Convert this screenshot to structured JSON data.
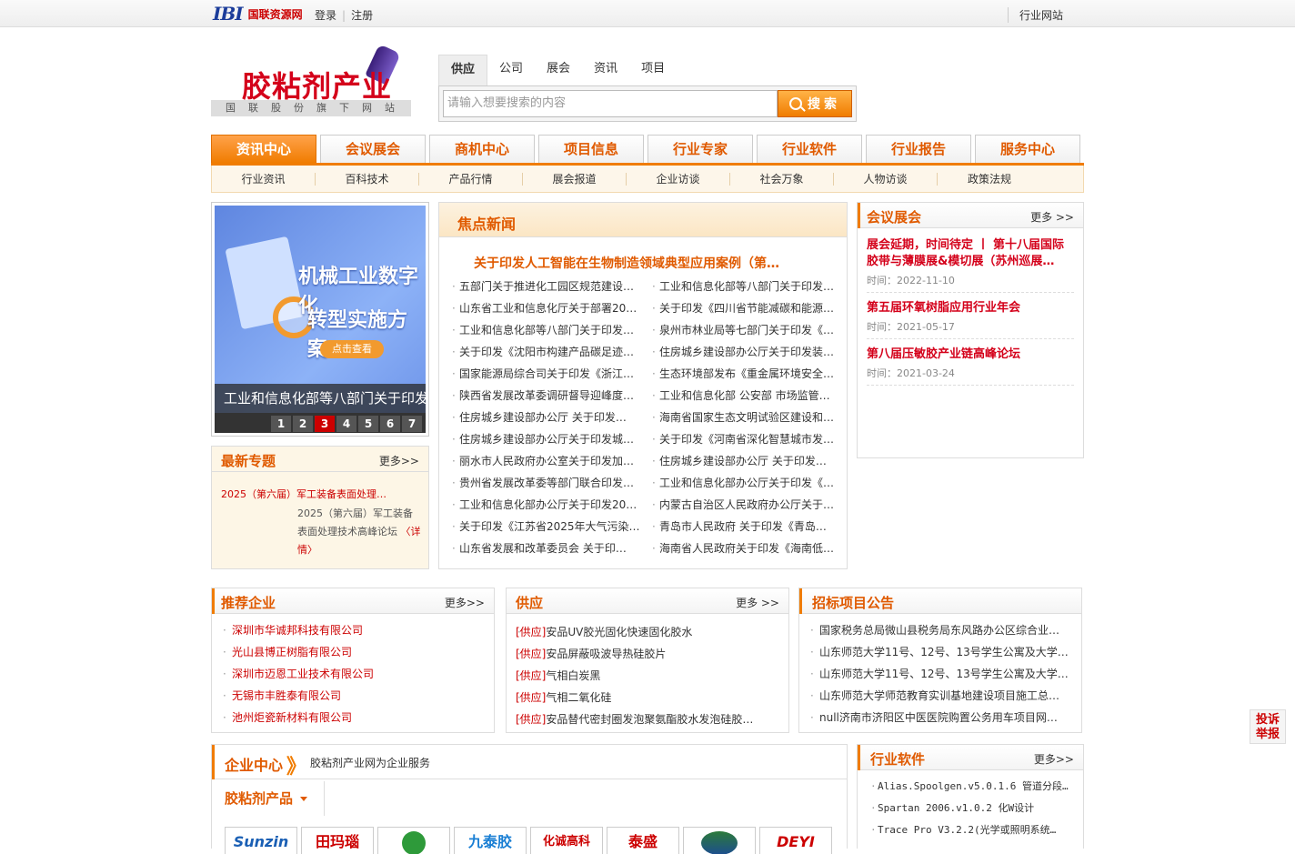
{
  "topbar": {
    "logo_text": "IBI",
    "site_name": "国联资源网",
    "login": "登录",
    "register": "注册",
    "industry_sites": "行业网站"
  },
  "brand": {
    "title": "胶粘剂产业",
    "subtitle": "国联股份旗下网站"
  },
  "search": {
    "tabs": [
      "供应",
      "公司",
      "展会",
      "资讯",
      "项目"
    ],
    "placeholder": "请输入想要搜索的内容",
    "button": "搜索"
  },
  "nav": {
    "items": [
      "资讯中心",
      "会议展会",
      "商机中心",
      "项目信息",
      "行业专家",
      "行业软件",
      "行业报告",
      "服务中心"
    ]
  },
  "subnav": {
    "items": [
      "行业资讯",
      "百科技术",
      "产品行情",
      "展会报道",
      "企业访谈",
      "社会万象",
      "人物访谈",
      "政策法规"
    ]
  },
  "slider": {
    "title_line1": "机械工业数字化",
    "title_line2": "转型实施方案",
    "button": "点击查看",
    "caption": "工业和信息化部等八部门关于印发",
    "dots": [
      "1",
      "2",
      "3",
      "4",
      "5",
      "6",
      "7"
    ],
    "active_dot": 3
  },
  "topic": {
    "title": "最新专题",
    "more": "更多>>",
    "lead": "2025（第六届）军工装备表面处理…",
    "desc": "2025（第六届）军工装备表面处理技术高峰论坛",
    "detail": "〈详情〉"
  },
  "focus": {
    "title": "焦点新闻",
    "headline": "关于印发人工智能在生物制造领域典型应用案例（第…",
    "left": [
      "五部门关于推进化工园区规范建设…",
      "山东省工业和信息化厅关于部署20…",
      "工业和信息化部等八部门关于印发…",
      "关于印发《沈阳市构建产品碳足迹…",
      "国家能源局综合司关于印发《浙江…",
      "陕西省发展改革委调研督导迎峰度…",
      "住房城乡建设部办公厅 关于印发…",
      "住房城乡建设部办公厅关于印发城…",
      "丽水市人民政府办公室关于印发加…",
      "贵州省发展改革委等部门联合印发…",
      "工业和信息化部办公厅关于印发20…",
      "关于印发《江苏省2025年大气污染…",
      "山东省发展和改革委员会 关于印…"
    ],
    "right": [
      "工业和信息化部等八部门关于印发…",
      "关于印发《四川省节能减碳和能源…",
      "泉州市林业局等七部门关于印发《…",
      "住房城乡建设部办公厅关于印发装…",
      "生态环境部发布《重金属环境安全…",
      "工业和信息化部 公安部 市场监管…",
      "海南省国家生态文明试验区建设和…",
      "关于印发《河南省深化智慧城市发…",
      "住房城乡建设部办公厅 关于印发…",
      "工业和信息化部办公厅关于印发《…",
      "内蒙古自治区人民政府办公厅关于…",
      "青岛市人民政府 关于印发《青岛…",
      "海南省人民政府关于印发《海南低…"
    ]
  },
  "meetings": {
    "title": "会议展会",
    "more": "更多 >>",
    "time_label": "时间：",
    "items": [
      {
        "title": "展会延期，时间待定 丨 第十八届国际胶带与薄膜展&模切展（苏州巡展…",
        "time": "2022-11-10"
      },
      {
        "title": "第五届环氧树脂应用行业年会",
        "time": "2021-05-17"
      },
      {
        "title": "第八届压敏胶产业链高峰论坛",
        "time": "2021-03-24"
      }
    ]
  },
  "recommend": {
    "title": "推荐企业",
    "more": "更多>>",
    "items": [
      "深圳市华诚邦科技有限公司",
      "光山县博正树脂有限公司",
      "深圳市迈恩工业技术有限公司",
      "无锡市丰胜泰有限公司",
      "池州炬瓷新材料有限公司"
    ]
  },
  "supply": {
    "title": "供应",
    "more": "更多 >>",
    "prefix": "[供应]",
    "items": [
      "安品UV胶光固化快速固化胶水",
      "安品屏蔽吸波导热硅胶片",
      "气相白炭黑",
      "气相二氧化硅",
      "安品替代密封圈发泡聚氨酯胶水发泡硅胶…"
    ]
  },
  "bids": {
    "title": "招标项目公告",
    "items": [
      "国家税务总局微山县税务局东风路办公区综合业…",
      "山东师范大学11号、12号、13号学生公寓及大学…",
      "山东师范大学11号、12号、13号学生公寓及大学…",
      "山东师范大学师范教育实训基地建设项目施工总…",
      "null济南市济阳区中医医院购置公务用车项目网…"
    ]
  },
  "enterprise": {
    "title": "企业中心",
    "slogan": "胶粘剂产业网为企业服务",
    "tab": "胶粘剂产品",
    "logos": [
      "Sunzin",
      "田玛瑙",
      "",
      "九泰胶",
      "化诚高科",
      "泰盛",
      "",
      "DEYI"
    ]
  },
  "software": {
    "title": "行业软件",
    "more": "更多>>",
    "items": [
      "Alias.Spoolgen.v5.0.1.6 管道分段…",
      "Spartan 2006.v1.0.2 化W设计",
      "Trace Pro V3.2.2(光学或照明系统…"
    ]
  },
  "report": {
    "label": "投诉举报"
  },
  "colors": {
    "accent": "#f07c00",
    "brand_red": "#d4001a"
  }
}
